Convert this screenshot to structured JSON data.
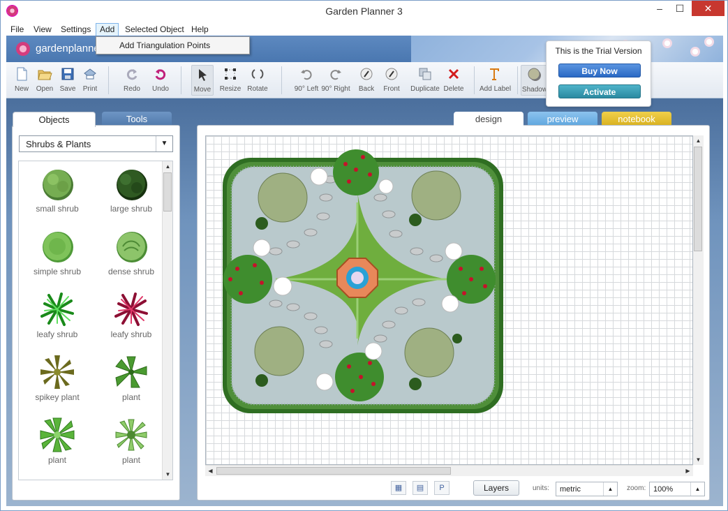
{
  "window": {
    "title": "Garden Planner 3"
  },
  "menu": {
    "items": [
      "File",
      "View",
      "Settings",
      "Add",
      "Selected Object",
      "Help"
    ],
    "open_menu_item": "Add Triangulation Points"
  },
  "banner": {
    "logo_text": "gardenplanner"
  },
  "toolbar": {
    "buttons": [
      {
        "label": "New",
        "icon": "new-file-icon"
      },
      {
        "label": "Open",
        "icon": "folder-open-icon"
      },
      {
        "label": "Save",
        "icon": "save-icon"
      },
      {
        "label": "Print",
        "icon": "print-icon"
      },
      {
        "label": "Redo",
        "icon": "redo-icon"
      },
      {
        "label": "Undo",
        "icon": "undo-icon"
      },
      {
        "label": "Move",
        "icon": "cursor-icon"
      },
      {
        "label": "Resize",
        "icon": "resize-icon"
      },
      {
        "label": "Rotate",
        "icon": "rotate-icon"
      },
      {
        "label": "90° Left",
        "icon": "rotate-left-icon"
      },
      {
        "label": "90° Right",
        "icon": "rotate-right-icon"
      },
      {
        "label": "Back",
        "icon": "send-back-icon"
      },
      {
        "label": "Front",
        "icon": "bring-front-icon"
      },
      {
        "label": "Duplicate",
        "icon": "duplicate-icon"
      },
      {
        "label": "Delete",
        "icon": "delete-icon"
      },
      {
        "label": "Add Label",
        "icon": "text-icon"
      },
      {
        "label": "Shadow",
        "icon": "shadow-icon"
      }
    ]
  },
  "trial": {
    "message": "This is the Trial Version",
    "buy_label": "Buy Now",
    "activate_label": "Activate"
  },
  "left_panel": {
    "tabs": [
      "Objects",
      "Tools"
    ],
    "category": "Shrubs & Plants",
    "plants": [
      {
        "label": "small shrub",
        "icon": "small-shrub-icon"
      },
      {
        "label": "large shrub",
        "icon": "large-shrub-icon"
      },
      {
        "label": "simple shrub",
        "icon": "simple-shrub-icon"
      },
      {
        "label": "dense shrub",
        "icon": "dense-shrub-icon"
      },
      {
        "label": "leafy shrub",
        "icon": "leafy-shrub-green-icon"
      },
      {
        "label": "leafy shrub",
        "icon": "leafy-shrub-red-icon"
      },
      {
        "label": "spikey plant",
        "icon": "spikey-plant-icon"
      },
      {
        "label": "plant",
        "icon": "plant-star-icon"
      },
      {
        "label": "plant",
        "icon": "plant-green-icon"
      },
      {
        "label": "plant",
        "icon": "plant-light-icon"
      }
    ]
  },
  "view_tabs": [
    "design",
    "preview",
    "notebook"
  ],
  "status": {
    "layers_label": "Layers",
    "units_label": "units:",
    "units_value": "metric",
    "zoom_label": "zoom:",
    "zoom_value": "100%",
    "p_label": "P"
  },
  "colors": {
    "accent_blue": "#4a77b0",
    "lawn_green": "#6fae3e",
    "hedge_green": "#3d7c2a",
    "close_red": "#c7372f",
    "notebook_yellow": "#d6ae1d"
  }
}
